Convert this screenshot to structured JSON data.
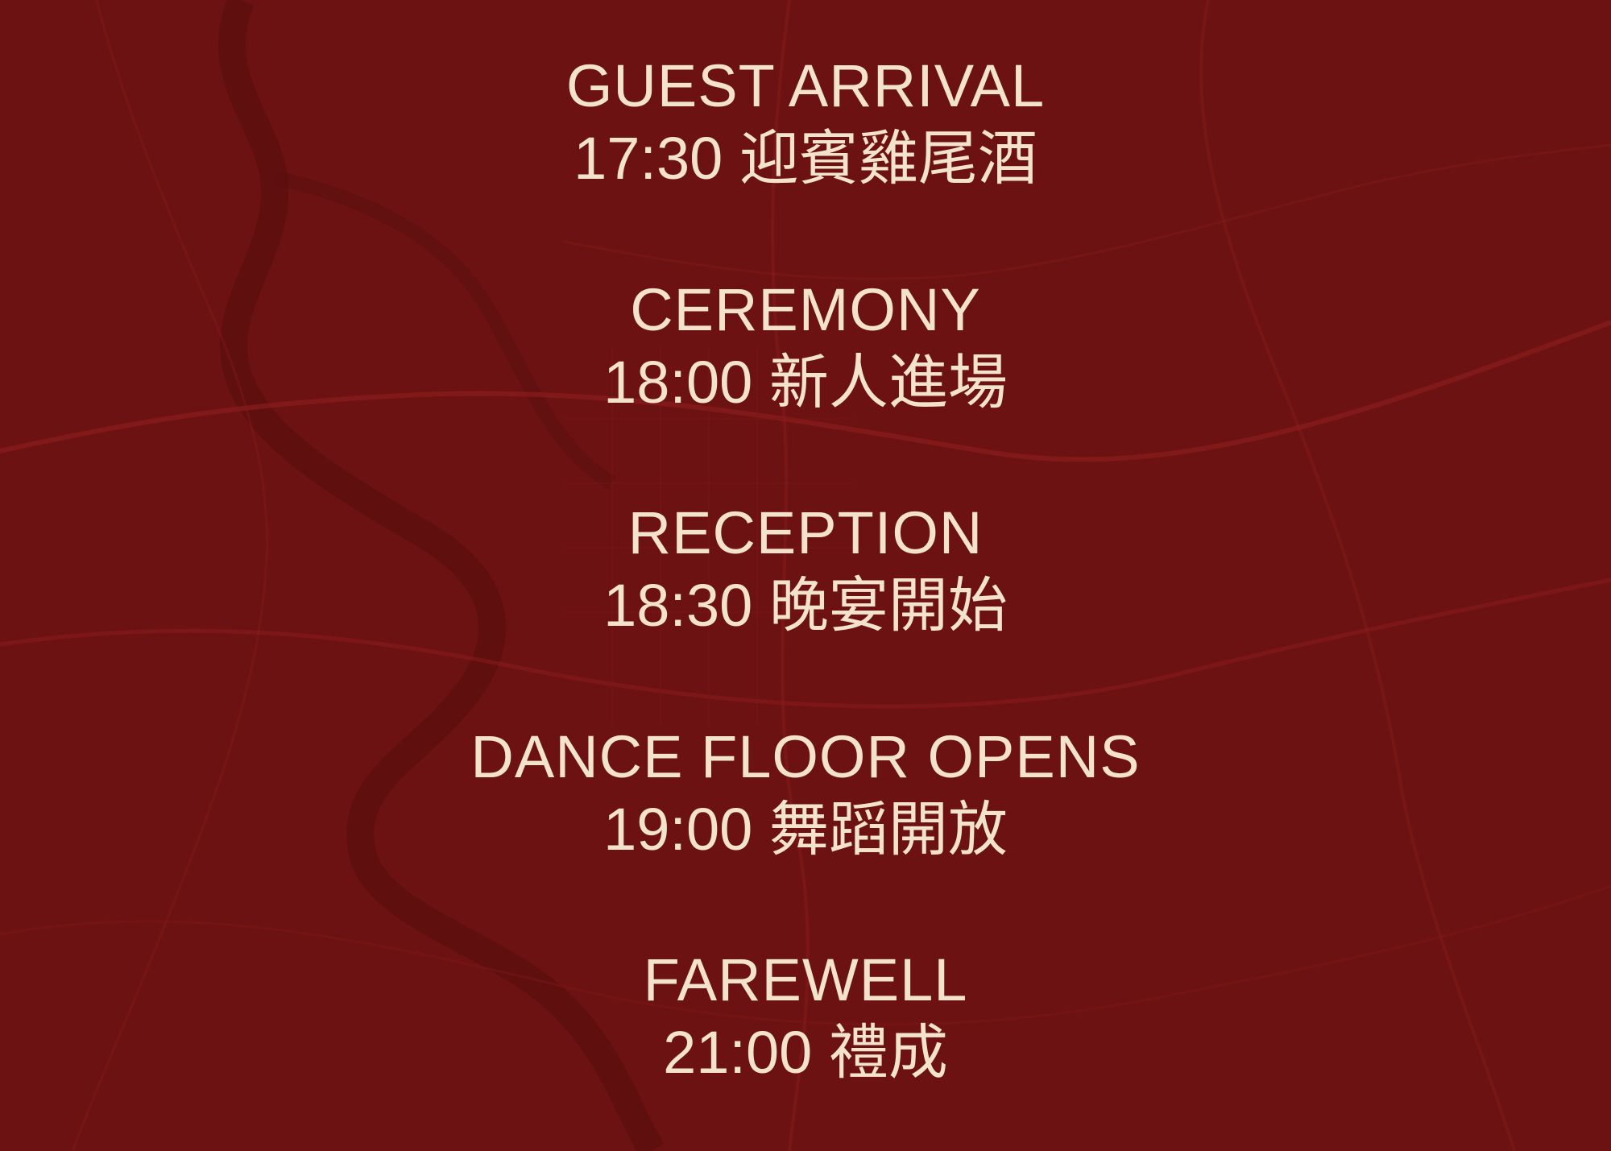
{
  "theme": {
    "background": "#6d1212",
    "text": "#f3e3cc",
    "map_line": "#8a1c1c",
    "map_river": "#5c0f0f"
  },
  "background": {
    "image": "map-background"
  },
  "schedule": [
    {
      "title": "GUEST ARRIVAL",
      "time_label": "17:30 迎賓雞尾酒"
    },
    {
      "title": "CEREMONY",
      "time_label": "18:00 新人進場"
    },
    {
      "title": "RECEPTION",
      "time_label": "18:30 晚宴開始"
    },
    {
      "title": "DANCE FLOOR OPENS",
      "time_label": "19:00 舞蹈開放"
    },
    {
      "title": "FAREWELL",
      "time_label": "21:00 禮成"
    }
  ]
}
